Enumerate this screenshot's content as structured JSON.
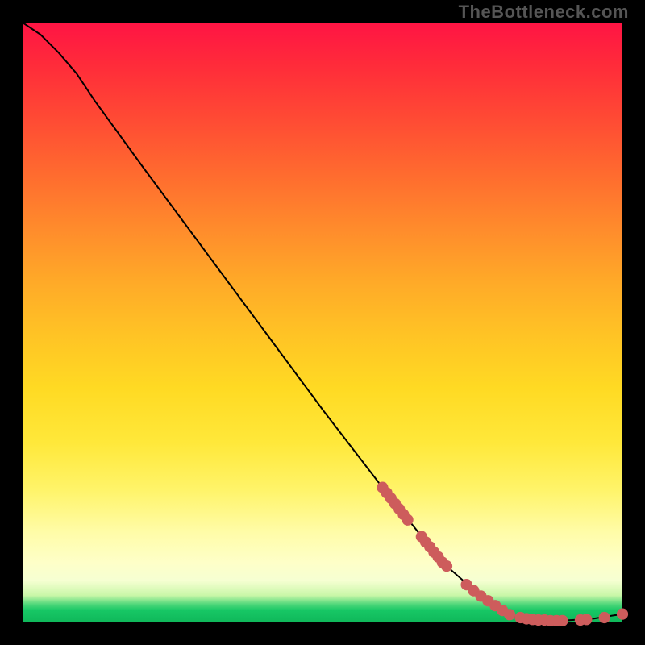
{
  "watermark": "TheBottleneck.com",
  "colors": {
    "dot": "#cd5c5c",
    "curve": "#000000",
    "frame": "#000000"
  },
  "chart_data": {
    "type": "line",
    "title": "",
    "xlabel": "",
    "ylabel": "",
    "xlim": [
      0,
      100
    ],
    "ylim": [
      0,
      100
    ],
    "grid": false,
    "legend": false,
    "curve": [
      {
        "x": 0,
        "y": 100
      },
      {
        "x": 3,
        "y": 98
      },
      {
        "x": 6,
        "y": 95
      },
      {
        "x": 9,
        "y": 91.5
      },
      {
        "x": 12,
        "y": 87
      },
      {
        "x": 20,
        "y": 76
      },
      {
        "x": 30,
        "y": 62.5
      },
      {
        "x": 40,
        "y": 49
      },
      {
        "x": 50,
        "y": 35.5
      },
      {
        "x": 60,
        "y": 22.5
      },
      {
        "x": 70,
        "y": 10
      },
      {
        "x": 78,
        "y": 3
      },
      {
        "x": 82,
        "y": 1
      },
      {
        "x": 86,
        "y": 0.4
      },
      {
        "x": 90,
        "y": 0.3
      },
      {
        "x": 95,
        "y": 0.6
      },
      {
        "x": 100,
        "y": 1.4
      }
    ],
    "dots": [
      {
        "x": 60,
        "y": 22.5
      },
      {
        "x": 60.7,
        "y": 21.6
      },
      {
        "x": 61.4,
        "y": 20.7
      },
      {
        "x": 62.1,
        "y": 19.8
      },
      {
        "x": 62.8,
        "y": 18.9
      },
      {
        "x": 63.5,
        "y": 18.0
      },
      {
        "x": 64.2,
        "y": 17.1
      },
      {
        "x": 66.5,
        "y": 14.3
      },
      {
        "x": 67.2,
        "y": 13.4
      },
      {
        "x": 67.9,
        "y": 12.6
      },
      {
        "x": 68.6,
        "y": 11.7
      },
      {
        "x": 69.3,
        "y": 10.9
      },
      {
        "x": 70.0,
        "y": 10.0
      },
      {
        "x": 70.7,
        "y": 9.4
      },
      {
        "x": 74.0,
        "y": 6.3
      },
      {
        "x": 75.2,
        "y": 5.3
      },
      {
        "x": 76.4,
        "y": 4.4
      },
      {
        "x": 77.6,
        "y": 3.6
      },
      {
        "x": 78.8,
        "y": 2.8
      },
      {
        "x": 80.0,
        "y": 2.0
      },
      {
        "x": 81.2,
        "y": 1.3
      },
      {
        "x": 83.0,
        "y": 0.8
      },
      {
        "x": 84.0,
        "y": 0.6
      },
      {
        "x": 85.0,
        "y": 0.5
      },
      {
        "x": 86.0,
        "y": 0.4
      },
      {
        "x": 87.0,
        "y": 0.4
      },
      {
        "x": 88.0,
        "y": 0.3
      },
      {
        "x": 89.0,
        "y": 0.3
      },
      {
        "x": 90.0,
        "y": 0.3
      },
      {
        "x": 93.0,
        "y": 0.4
      },
      {
        "x": 94.0,
        "y": 0.5
      },
      {
        "x": 97.0,
        "y": 0.8
      },
      {
        "x": 100.0,
        "y": 1.4
      }
    ],
    "dot_radius_data_units": 0.95
  }
}
